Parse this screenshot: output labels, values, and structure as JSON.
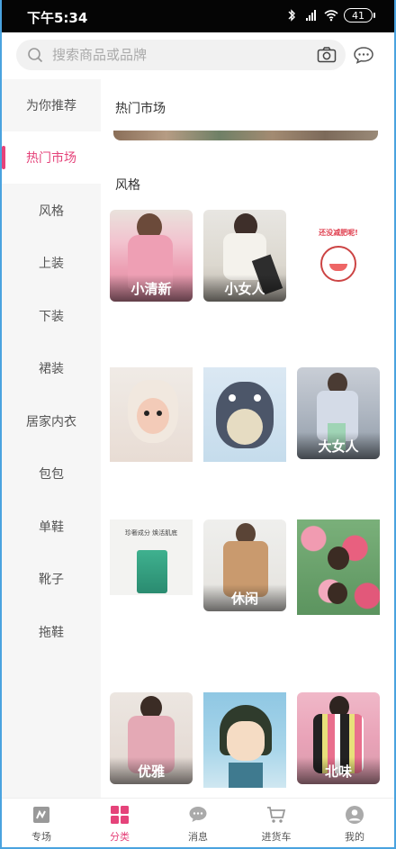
{
  "status_bar": {
    "time": "下午5:34",
    "battery": "41",
    "icons": [
      "bluetooth-icon",
      "signal-icon",
      "wifi-icon",
      "battery-icon"
    ]
  },
  "search": {
    "placeholder": "搜索商品或品牌"
  },
  "sidebar": {
    "items": [
      {
        "label": "为你推荐"
      },
      {
        "label": "热门市场"
      },
      {
        "label": "风格"
      },
      {
        "label": "上装"
      },
      {
        "label": "下装"
      },
      {
        "label": "裙装"
      },
      {
        "label": "居家内衣"
      },
      {
        "label": "包包"
      },
      {
        "label": "单鞋"
      },
      {
        "label": "靴子"
      },
      {
        "label": "拖鞋"
      }
    ],
    "active_index": 1
  },
  "content": {
    "section_hot": "热门市场",
    "section_style": "风格",
    "tiles": [
      {
        "caption": "小清新"
      },
      {
        "caption": "小女人"
      },
      {
        "caption": "",
        "overlay_text": "还没减肥呢!"
      },
      {
        "caption": ""
      },
      {
        "caption": ""
      },
      {
        "caption": "大女人"
      },
      {
        "caption": "",
        "overlay_text_1": "珍奢成分 焕活肌底"
      },
      {
        "caption": "休闲"
      },
      {
        "caption": ""
      },
      {
        "caption": "优雅"
      },
      {
        "caption": ""
      },
      {
        "caption": "北味"
      }
    ]
  },
  "bottom_nav": {
    "items": [
      {
        "label": "专场",
        "icon": "special-icon"
      },
      {
        "label": "分类",
        "icon": "category-icon"
      },
      {
        "label": "消息",
        "icon": "message-icon"
      },
      {
        "label": "进货车",
        "icon": "cart-icon"
      },
      {
        "label": "我的",
        "icon": "profile-icon"
      }
    ],
    "active_index": 1
  },
  "colors": {
    "accent": "#e5437a",
    "sidebar_bg": "#f6f6f6",
    "status_bar_bg": "#050505"
  }
}
